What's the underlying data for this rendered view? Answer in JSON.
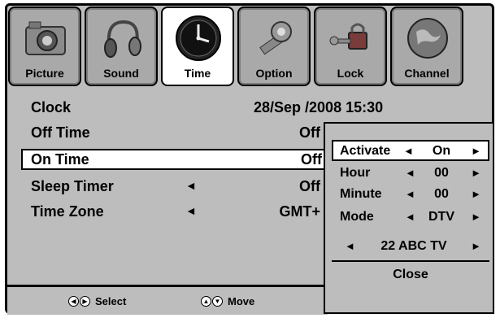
{
  "tabs": [
    {
      "label": "Picture",
      "icon": "camera-icon",
      "active": false
    },
    {
      "label": "Sound",
      "icon": "headphones-icon",
      "active": false
    },
    {
      "label": "Time",
      "icon": "clock-icon",
      "active": true
    },
    {
      "label": "Option",
      "icon": "gear-icon",
      "active": false
    },
    {
      "label": "Lock",
      "icon": "lock-icon",
      "active": false
    },
    {
      "label": "Channel",
      "icon": "globe-icon",
      "active": false
    }
  ],
  "menu": {
    "clock": {
      "label": "Clock",
      "value": "28/Sep  /2008 15:30"
    },
    "off_time": {
      "label": "Off Time",
      "value": "Off"
    },
    "on_time": {
      "label": "On Time",
      "value": "Off"
    },
    "sleep_timer": {
      "label": "Sleep Timer",
      "value": "Off"
    },
    "time_zone": {
      "label": "Time Zone",
      "value": "GMT+"
    }
  },
  "popup": {
    "activate": {
      "label": "Activate",
      "value": "On"
    },
    "hour": {
      "label": "Hour",
      "value": "00"
    },
    "minute": {
      "label": "Minute",
      "value": "00"
    },
    "mode": {
      "label": "Mode",
      "value": "DTV"
    },
    "channel": {
      "value": "22 ABC TV"
    },
    "close_label": "Close"
  },
  "footer": {
    "select_label": "Select",
    "move_label": "Move"
  },
  "glyphs": {
    "left": "◄",
    "right": "►"
  },
  "colors": {
    "background": "#bdbdbd",
    "highlight": "#ffffff",
    "text": "#000000"
  }
}
